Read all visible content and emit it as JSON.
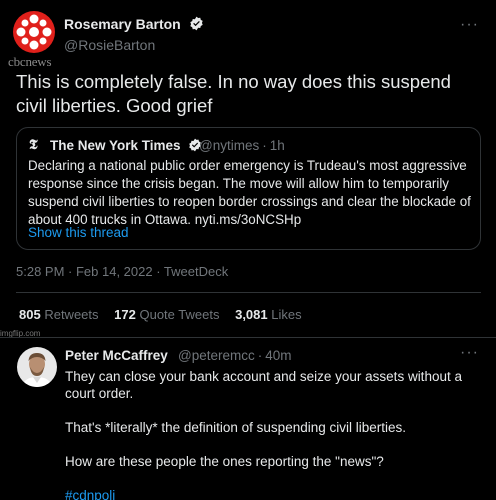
{
  "main_tweet": {
    "author_name": "Rosemary Barton",
    "author_handle": "@RosieBarton",
    "brand_wordmark": "cbcnews",
    "text": "This is completely false. In no way does this suspend civil liberties. Good grief",
    "more_icon": "more-horizontal-icon",
    "quote": {
      "source_logo": "𝕿",
      "name": "The New York Times",
      "handle": "@nytimes",
      "separator": "·",
      "time": "1h",
      "text": "Declaring a national public order emergency is Trudeau's most aggressive response since the crisis began. The move will allow him to temporarily suspend civil liberties to reopen border crossings and clear the blockade of about 400 trucks in Ottawa. nyti.ms/3oNCSHp",
      "show_thread": "Show this thread"
    },
    "timestamp": "5:28 PM · Feb 14, 2022 · TweetDeck",
    "stats": {
      "retweets_count": "805",
      "retweets_label": "Retweets",
      "quotes_count": "172",
      "quotes_label": "Quote Tweets",
      "likes_count": "3,081",
      "likes_label": "Likes"
    }
  },
  "watermark": "imgflip.com",
  "reply": {
    "author_name": "Peter McCaffrey",
    "author_handle": "@peteremcc",
    "separator": "·",
    "time": "40m",
    "paragraphs": [
      "They can close your bank account and seize your assets without a court order.",
      "That's *literally* the definition of suspending civil liberties.",
      "How are these people the ones reporting the \"news\"?"
    ],
    "hashtag": "#cdnpoli"
  },
  "colors": {
    "background": "#000000",
    "text_primary": "#e7e9ea",
    "text_secondary": "#71767b",
    "link": "#1d9bf0",
    "border": "#2f3336",
    "cbc_red": "#e0201b"
  }
}
